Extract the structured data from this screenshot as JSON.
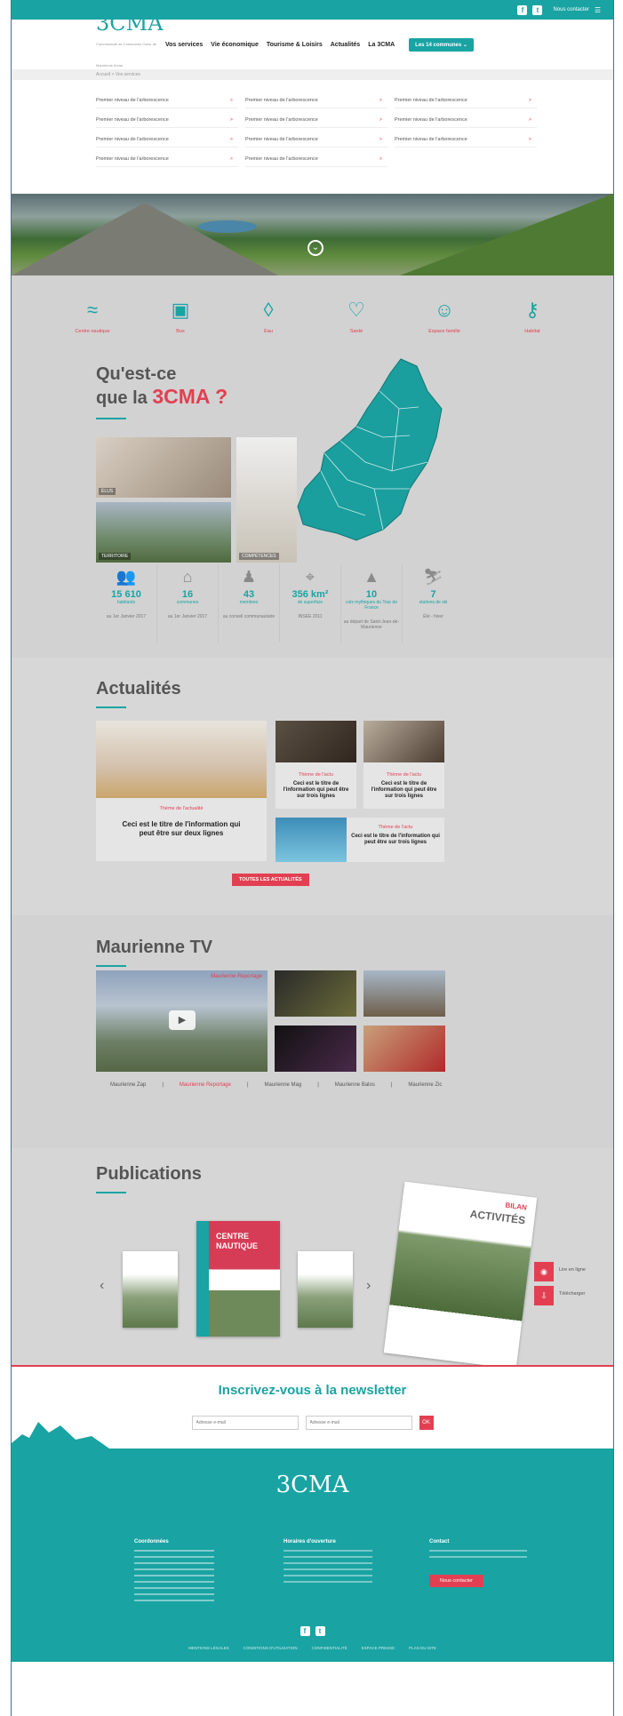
{
  "topbar": {
    "social": [
      "f",
      "t"
    ],
    "newsletter": "Nous contacter"
  },
  "header": {
    "logo_text": "3CMA",
    "logo_sub": "Communauté de Communes Cœur de Maurienne Arvan",
    "nav": [
      "Vos services",
      "Vie économique",
      "Tourisme & Loisirs",
      "Actualités",
      "La 3CMA"
    ],
    "cta": "Les 14 communes"
  },
  "breadcrumb": "Accueil  >  Vos services",
  "mega_menu": {
    "items": [
      "Premier niveau de l'arborescence",
      "Premier niveau de l'arborescence",
      "Premier niveau de l'arborescence",
      "Premier niveau de l'arborescence",
      "Premier niveau de l'arborescence",
      "Premier niveau de l'arborescence",
      "Premier niveau de l'arborescence",
      "Premier niveau de l'arborescence",
      "Premier niveau de l'arborescence",
      "Premier niveau de l'arborescence",
      "Premier niveau de l'arborescence"
    ],
    "arrow": ">"
  },
  "services": [
    {
      "label": "Centre nautique",
      "icon": "swimmer-icon",
      "glyph": "≈"
    },
    {
      "label": "Bus",
      "icon": "bus-icon",
      "glyph": "▣"
    },
    {
      "label": "Eau",
      "icon": "water-drop-icon",
      "glyph": "◊"
    },
    {
      "label": "Santé",
      "icon": "heart-icon",
      "glyph": "♡"
    },
    {
      "label": "Espace famille",
      "icon": "baby-face-icon",
      "glyph": "☺"
    },
    {
      "label": "Habitat",
      "icon": "key-icon",
      "glyph": "⚷"
    }
  ],
  "about": {
    "title_line1": "Qu'est-ce",
    "title_line2": "que la",
    "title_accent": "3CMA ?",
    "photos": [
      "ÉLUS",
      "TERRITOIRE",
      "COMPÉTENCES"
    ]
  },
  "stats": [
    {
      "number": "15 610",
      "label": "habitants",
      "date": "au 1er Janvier 2017",
      "icon": "people-icon"
    },
    {
      "number": "16",
      "label": "communes",
      "date": "au 1er Janvier 2017",
      "icon": "village-icon"
    },
    {
      "number": "43",
      "label": "membres",
      "date": "au conseil communautaire",
      "icon": "council-icon"
    },
    {
      "number": "356 km²",
      "label": "de superficie",
      "date": "INSEE 2011",
      "icon": "map-pin-icon"
    },
    {
      "number": "10",
      "label": "cols mythiques du Tour de France",
      "date": "au départ de Saint-Jean-de-Maurienne",
      "icon": "summit-icon"
    },
    {
      "number": "7",
      "label": "stations de ski",
      "date": "Été - hiver",
      "icon": "skier-icon"
    }
  ],
  "news": {
    "title": "Actualités",
    "main": {
      "theme": "Thème de l'actualité",
      "title": "Ceci est le titre de l'information qui peut être sur deux lignes"
    },
    "small": [
      {
        "theme": "Thème de l'actu",
        "title": "Ceci est le titre de l'information qui peut être sur trois lignes"
      },
      {
        "theme": "Thème de l'actu",
        "title": "Ceci est le titre de l'information qui peut être sur trois lignes"
      },
      {
        "theme": "Thème de l'actu",
        "title": "Ceci est le titre de l'information qui peut être sur trois lignes"
      }
    ],
    "button": "TOUTES LES ACTUALITÉS"
  },
  "tv": {
    "title": "Maurienne TV",
    "tabs": [
      "Maurienne Zap",
      "Maurienne Reportage",
      "Maurienne Mag",
      "Maurienne Balos",
      "Maurienne Zic"
    ],
    "active_tab": 1,
    "brand": "Maurienne Reportage"
  },
  "publications": {
    "title": "Publications",
    "featured_title": "CENTRE NAUTIQUE",
    "big_title": "ACTIVITÉS",
    "big_sub": "BILAN",
    "read": "Lire en ligne",
    "download": "Télécharger",
    "prev": "‹",
    "next": "›"
  },
  "newsletter": {
    "title": "Inscrivez-vous à la newsletter",
    "placeholder1": "Adresse e-mail",
    "placeholder2": "Adresse e-mail",
    "submit": "OK"
  },
  "footer": {
    "logo": "3CMA",
    "col1_title": "Coordonnées",
    "col2_title": "Horaires d'ouverture",
    "col3_title": "Contact",
    "contact_btn": "Nous contacter",
    "links": [
      "MENTIONS LÉGALES",
      "CONDITIONS D'UTILISATION",
      "CONFIDENTIALITÉ",
      "ESPACE PRESSE",
      "PLAN DU SITE"
    ]
  },
  "colors": {
    "teal": "#1aa3a3",
    "red": "#e24052",
    "grey": "#d2d2d2"
  }
}
